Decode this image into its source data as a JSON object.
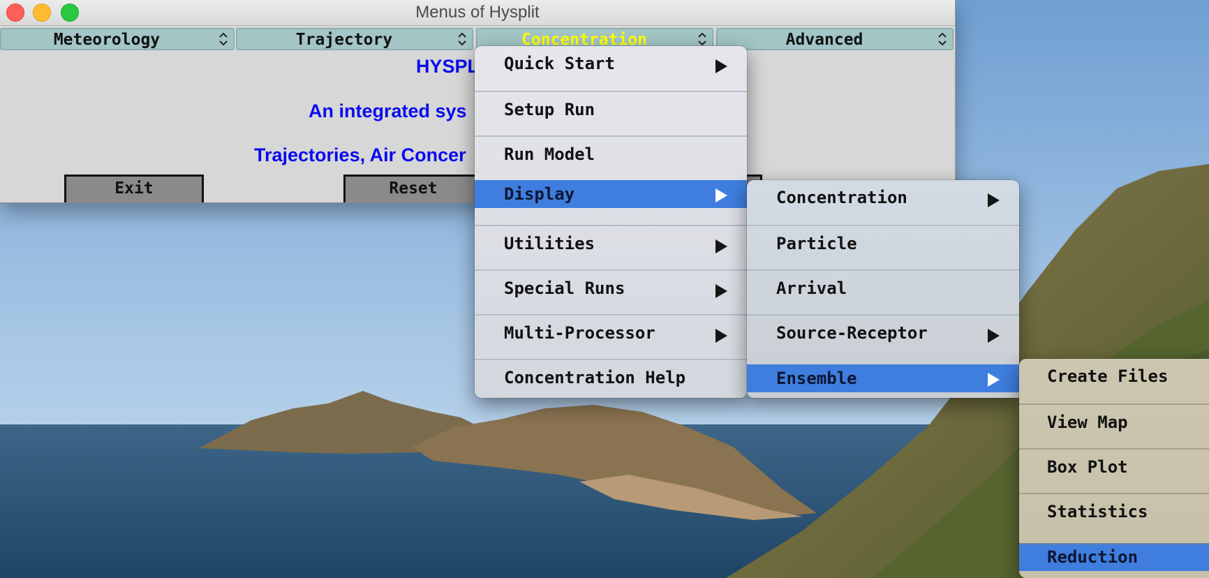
{
  "window": {
    "title": "Menus of Hysplit",
    "menubar": [
      {
        "label": "Meteorology"
      },
      {
        "label": "Trajectory"
      },
      {
        "label": "Concentration",
        "active": true
      },
      {
        "label": "Advanced"
      }
    ],
    "body": {
      "heading_visible": "HYSPL",
      "line1_visible": "An integrated sys",
      "line2_visible": "Trajectories, Air Concer"
    },
    "buttons": {
      "exit": "Exit",
      "reset": "Reset"
    }
  },
  "menus": {
    "concentration": [
      {
        "label": "Quick Start",
        "submenu": true
      },
      {
        "label": "Setup Run",
        "submenu": false
      },
      {
        "label": "Run Model",
        "submenu": false
      },
      {
        "label": "Display",
        "submenu": true,
        "selected": true
      },
      {
        "label": "Utilities",
        "submenu": true
      },
      {
        "label": "Special Runs",
        "submenu": true
      },
      {
        "label": "Multi-Processor",
        "submenu": true
      },
      {
        "label": "Concentration Help",
        "submenu": false
      }
    ],
    "display": [
      {
        "label": "Concentration",
        "submenu": true
      },
      {
        "label": "Particle",
        "submenu": false
      },
      {
        "label": "Arrival",
        "submenu": false
      },
      {
        "label": "Source-Receptor",
        "submenu": true
      },
      {
        "label": "Ensemble",
        "submenu": true,
        "selected": true
      }
    ],
    "ensemble": [
      {
        "label": "Create Files"
      },
      {
        "label": "View Map"
      },
      {
        "label": "Box Plot"
      },
      {
        "label": "Statistics"
      },
      {
        "label": "Reduction",
        "selected": true
      }
    ]
  },
  "colors": {
    "selection": "#3f7ede",
    "menubutton_bg": "#a3c5c5",
    "active_menubutton_text": "#ffff00",
    "body_text": "#0a0af0"
  }
}
